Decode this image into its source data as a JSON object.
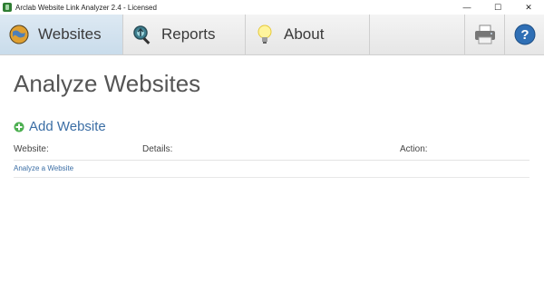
{
  "window": {
    "title": "Arclab Website Link Analyzer 2.4 - Licensed",
    "minimize": "—",
    "maximize": "☐",
    "close": "✕"
  },
  "toolbar": {
    "tabs": [
      {
        "label": "Websites",
        "icon": "globe-icon",
        "active": true
      },
      {
        "label": "Reports",
        "icon": "magnifier-icon",
        "active": false
      },
      {
        "label": "About",
        "icon": "lightbulb-icon",
        "active": false
      }
    ],
    "print_icon": "printer-icon",
    "help_icon": "help-icon"
  },
  "main": {
    "title": "Analyze Websites",
    "add_label": "Add Website",
    "table": {
      "headers": [
        "Website:",
        "Details:",
        "Action:"
      ],
      "rows": [
        {
          "link": "Analyze a Website"
        }
      ]
    }
  },
  "colors": {
    "active_tab": "#c9dceb",
    "link": "#3b6ea5",
    "add_icon": "#4caf50"
  }
}
